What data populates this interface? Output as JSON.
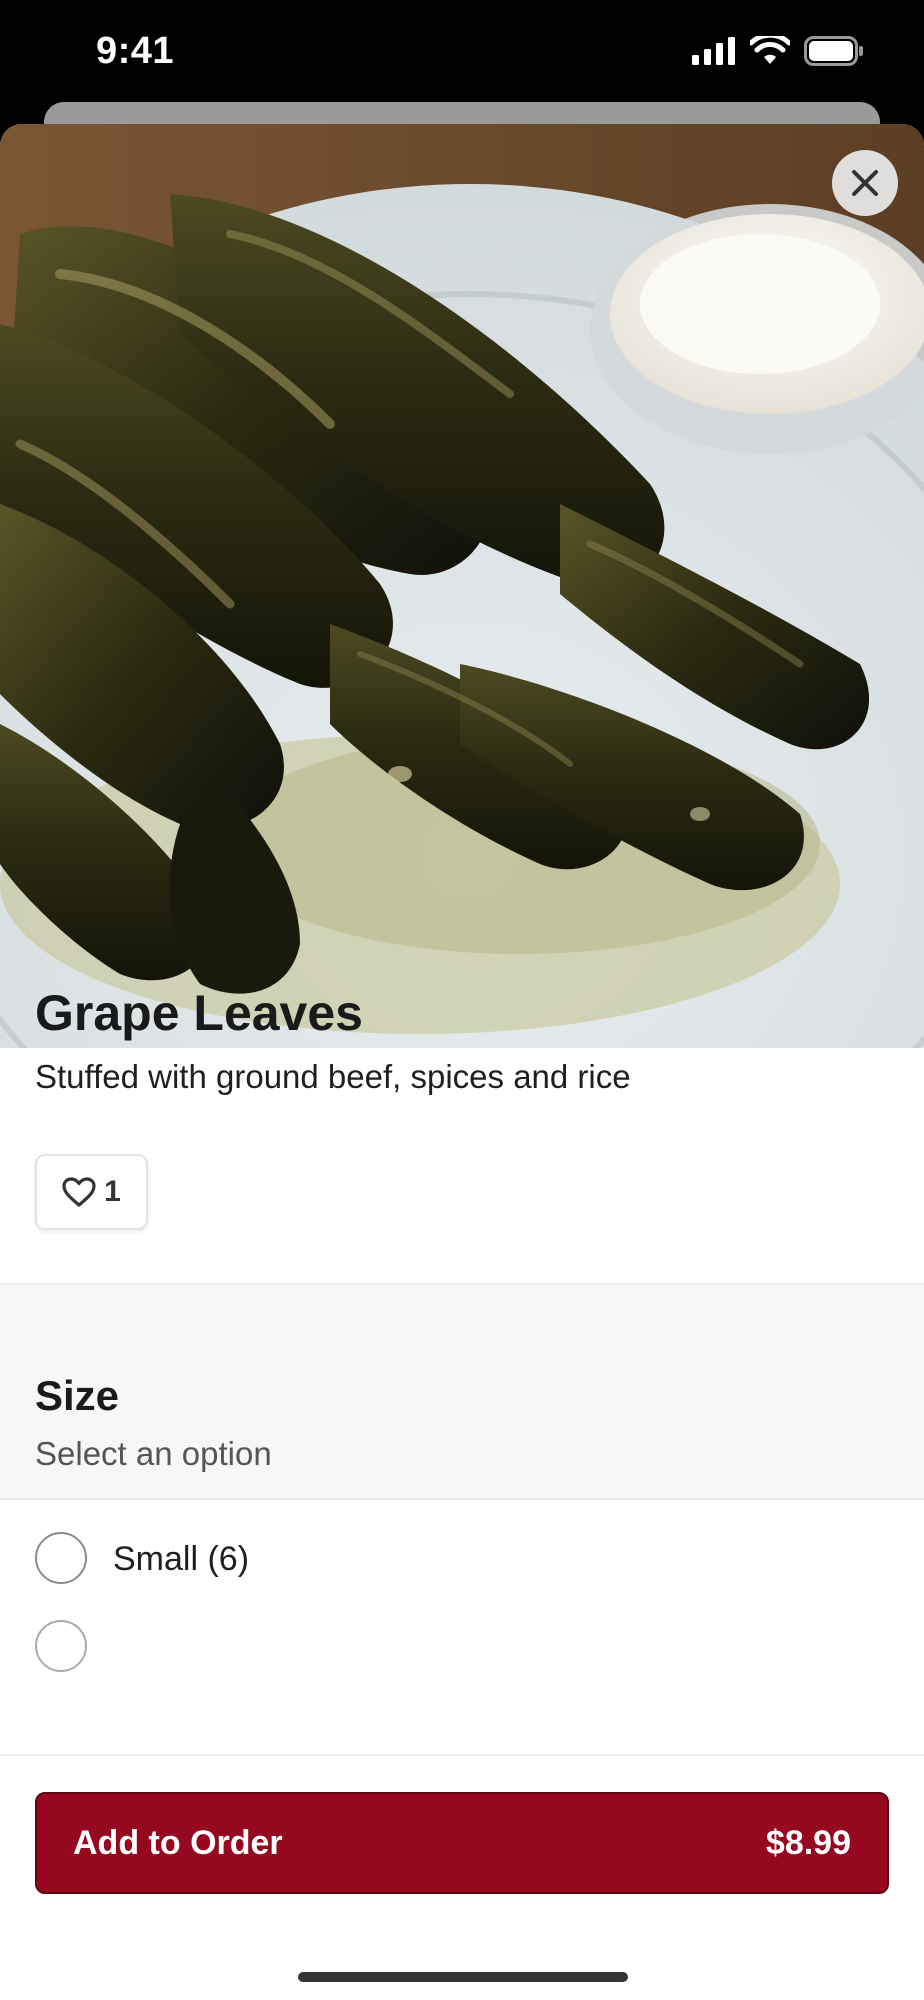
{
  "status_bar": {
    "time": "9:41",
    "icons": [
      "cellular-signal-icon",
      "wifi-icon",
      "battery-icon"
    ]
  },
  "item": {
    "title": "Grape Leaves",
    "description": "Stuffed with ground beef, spices and rice",
    "likes": "1",
    "image_alt": "Photo of stuffed grape leaves on a white plate with a cup of sauce"
  },
  "options": {
    "title": "Size",
    "subtitle": "Select an option",
    "choices": [
      {
        "label": "Small (6)",
        "selected": false
      }
    ]
  },
  "footer": {
    "button_label": "Add to Order",
    "price": "$8.99"
  },
  "colors": {
    "accent": "#960820",
    "section_bg": "#f7f7f7"
  }
}
